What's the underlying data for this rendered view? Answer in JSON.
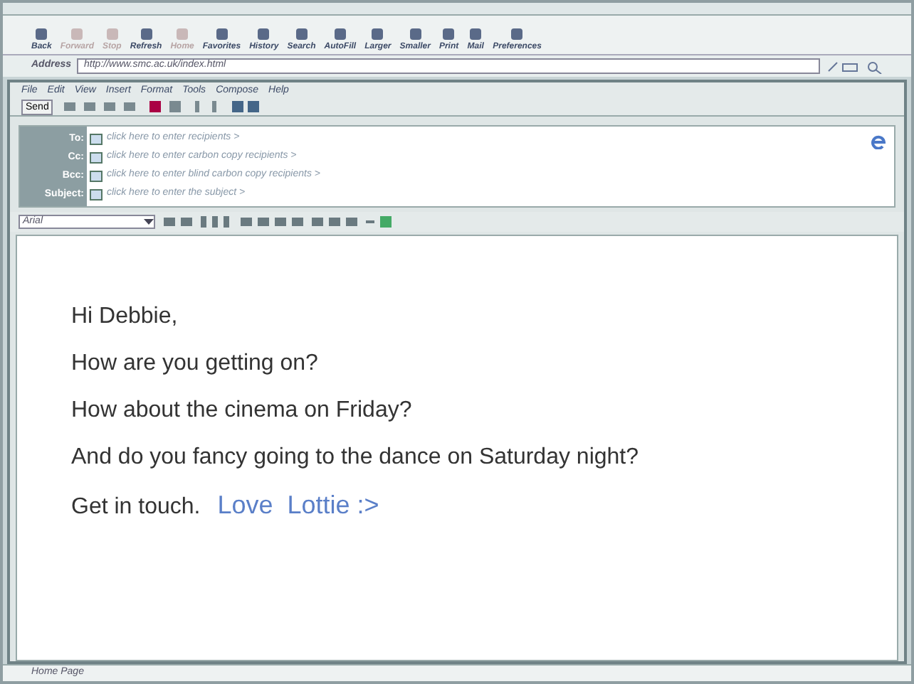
{
  "browser_toolbar": [
    {
      "label": "Back",
      "disabled": false
    },
    {
      "label": "Forward",
      "disabled": true
    },
    {
      "label": "Stop",
      "disabled": true
    },
    {
      "label": "Refresh",
      "disabled": false
    },
    {
      "label": "Home",
      "disabled": true
    },
    {
      "label": "Favorites",
      "disabled": false
    },
    {
      "label": "History",
      "disabled": false
    },
    {
      "label": "Search",
      "disabled": false
    },
    {
      "label": "AutoFill",
      "disabled": false
    },
    {
      "label": "Larger",
      "disabled": false
    },
    {
      "label": "Smaller",
      "disabled": false
    },
    {
      "label": "Print",
      "disabled": false
    },
    {
      "label": "Mail",
      "disabled": false
    },
    {
      "label": "Preferences",
      "disabled": false
    }
  ],
  "address": {
    "label": "Address",
    "value": "http://www.smc.ac.uk/index.html"
  },
  "compose": {
    "menu": [
      "File",
      "Edit",
      "View",
      "Insert",
      "Format",
      "Tools",
      "Compose",
      "Help"
    ],
    "send_label": "Send",
    "fields": [
      {
        "label": "To:",
        "placeholder": "click here to enter recipients >"
      },
      {
        "label": "Cc:",
        "placeholder": "click here to enter carbon copy recipients >"
      },
      {
        "label": "Bcc:",
        "placeholder": "click here to enter blind carbon copy recipients >"
      },
      {
        "label": "Subject:",
        "placeholder": "click here to enter the subject >"
      }
    ],
    "font": "Arial",
    "body": [
      {
        "text": "Hi Debbie,"
      },
      {
        "text": "How are you getting on?"
      },
      {
        "text": "How about the cinema on Friday?"
      },
      {
        "text": "And do you fancy going to the dance on Saturday night?"
      },
      {
        "text": "Get in touch.",
        "signoff": "Love  Lottie :>"
      }
    ]
  },
  "status_bar": "Home Page"
}
